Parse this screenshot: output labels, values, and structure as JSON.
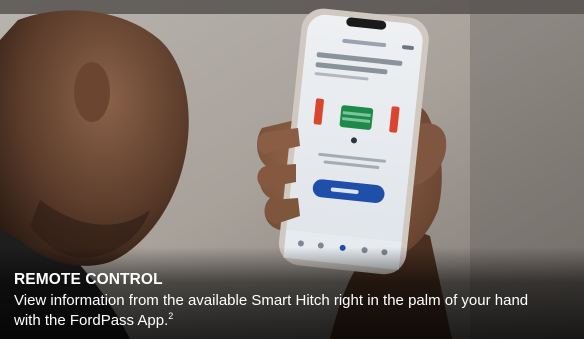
{
  "caption": {
    "title": "REMOTE CONTROL",
    "body": "View information from the available Smart Hitch right in the palm of your hand with the FordPass App.",
    "footnote": "2"
  },
  "colors": {
    "wall": "#a9a39c",
    "skin": "#8a6046",
    "phone_frame": "#c9c3bc",
    "screen_green": "#1e8a4a",
    "screen_red": "#d9452f",
    "app_button": "#1f4fa8"
  }
}
